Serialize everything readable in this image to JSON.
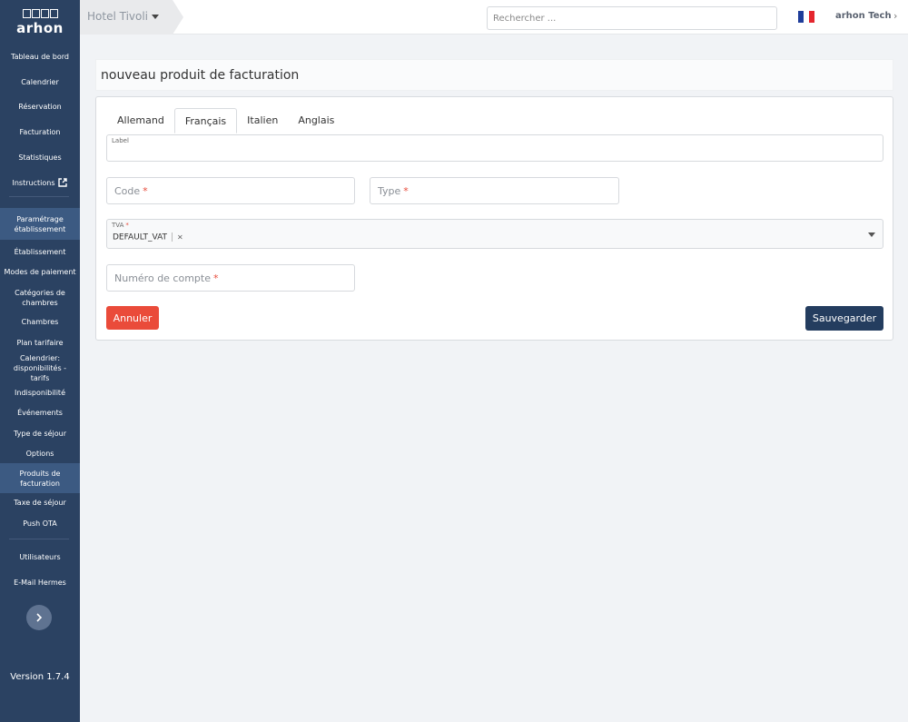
{
  "sidebar": {
    "logo_text": "arhon",
    "items": [
      {
        "label": "Tableau de bord"
      },
      {
        "label": "Calendrier"
      },
      {
        "label": "Réservation"
      },
      {
        "label": "Facturation"
      },
      {
        "label": "Statistiques"
      },
      {
        "label": "Instructions"
      },
      {
        "label": "Paramétrage établissement"
      },
      {
        "label": "Établissement"
      },
      {
        "label": "Modes de paiement"
      },
      {
        "label": "Catégories de chambres"
      },
      {
        "label": "Chambres"
      },
      {
        "label": "Plan tarifaire"
      },
      {
        "label": "Calendrier: disponibilités - tarifs"
      },
      {
        "label": "Indisponibilité"
      },
      {
        "label": "Événements"
      },
      {
        "label": "Type de séjour"
      },
      {
        "label": "Options"
      },
      {
        "label": "Produits de facturation"
      },
      {
        "label": "Taxe de séjour"
      },
      {
        "label": "Push OTA"
      },
      {
        "label": "Utilisateurs"
      },
      {
        "label": "E-Mail Hermes"
      }
    ],
    "version": "Version 1.7.4"
  },
  "header": {
    "hotel": "Hotel Tivoli",
    "search_placeholder": "Rechercher ...",
    "flag_colors": [
      "#1f3d9a",
      "#ffffff",
      "#e4262e"
    ],
    "user": "arhon Tech"
  },
  "page": {
    "title": "nouveau produit de facturation",
    "tabs": [
      {
        "label": "Allemand"
      },
      {
        "label": "Français"
      },
      {
        "label": "Italien"
      },
      {
        "label": "Anglais"
      }
    ],
    "active_tab": "Français",
    "form": {
      "label_field": {
        "label": "Label",
        "value": ""
      },
      "code_field": {
        "placeholder": "Code",
        "required": "*"
      },
      "type_field": {
        "placeholder": "Type",
        "required": "*"
      },
      "tva_field": {
        "label": "TVA",
        "required": "*",
        "value": "DEFAULT_VAT",
        "clear": "×"
      },
      "account_field": {
        "placeholder": "Numéro de compte",
        "required": "*"
      }
    },
    "buttons": {
      "cancel": "Annuler",
      "save": "Sauvegarder"
    }
  },
  "colors": {
    "sidebar_bg": "#2b4262",
    "sidebar_active": "#3c5a82",
    "cancel_bg": "#ea4b3a",
    "save_bg": "#243d5f",
    "required": "#e74c3c"
  }
}
